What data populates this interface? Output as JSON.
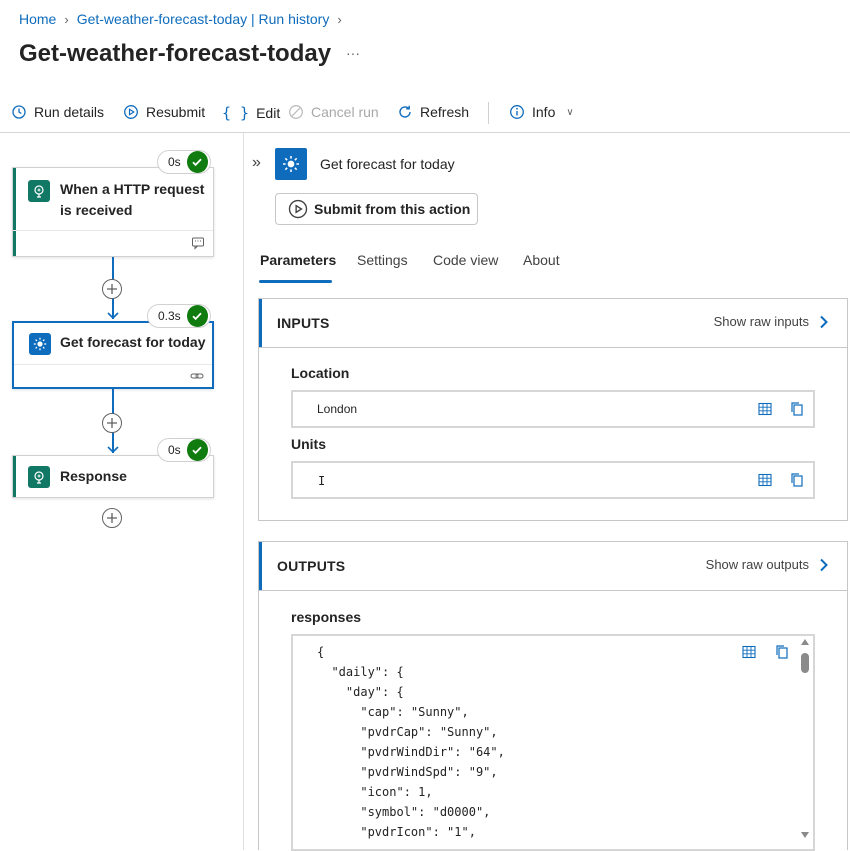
{
  "breadcrumb": {
    "home": "Home",
    "run_history": "Get-weather-forecast-today | Run history"
  },
  "page": {
    "title": "Get-weather-forecast-today",
    "more": "···"
  },
  "toolbar": {
    "run_details": "Run details",
    "resubmit": "Resubmit",
    "edit": "Edit",
    "cancel_run": "Cancel run",
    "refresh": "Refresh",
    "info": "Info"
  },
  "flow": {
    "nodes": [
      {
        "label": "When a HTTP request is received",
        "duration": "0s",
        "status": "success"
      },
      {
        "label": "Get forecast for today",
        "duration": "0.3s",
        "status": "success"
      },
      {
        "label": "Response",
        "duration": "0s",
        "status": "success"
      }
    ]
  },
  "detail": {
    "action_title": "Get forecast for today",
    "submit_button": "Submit from this action",
    "tabs": [
      "Parameters",
      "Settings",
      "Code view",
      "About"
    ],
    "active_tab": "Parameters",
    "inputs": {
      "title": "INPUTS",
      "raw_link": "Show raw inputs",
      "fields": [
        {
          "label": "Location",
          "value": "London"
        },
        {
          "label": "Units",
          "value": "I"
        }
      ]
    },
    "outputs": {
      "title": "OUTPUTS",
      "raw_link": "Show raw outputs",
      "field_label": "responses",
      "code_lines": [
        "{",
        "  \"daily\": {",
        "    \"day\": {",
        "      \"cap\": \"Sunny\",",
        "      \"pvdrCap\": \"Sunny\",",
        "      \"pvdrWindDir\": \"64\",",
        "      \"pvdrWindSpd\": \"9\",",
        "      \"icon\": 1,",
        "      \"symbol\": \"d0000\",",
        "      \"pvdrIcon\": \"1\","
      ]
    }
  },
  "colors": {
    "accent": "#0f6cbd",
    "success": "#107c10",
    "trigger_teal": "#117865"
  }
}
